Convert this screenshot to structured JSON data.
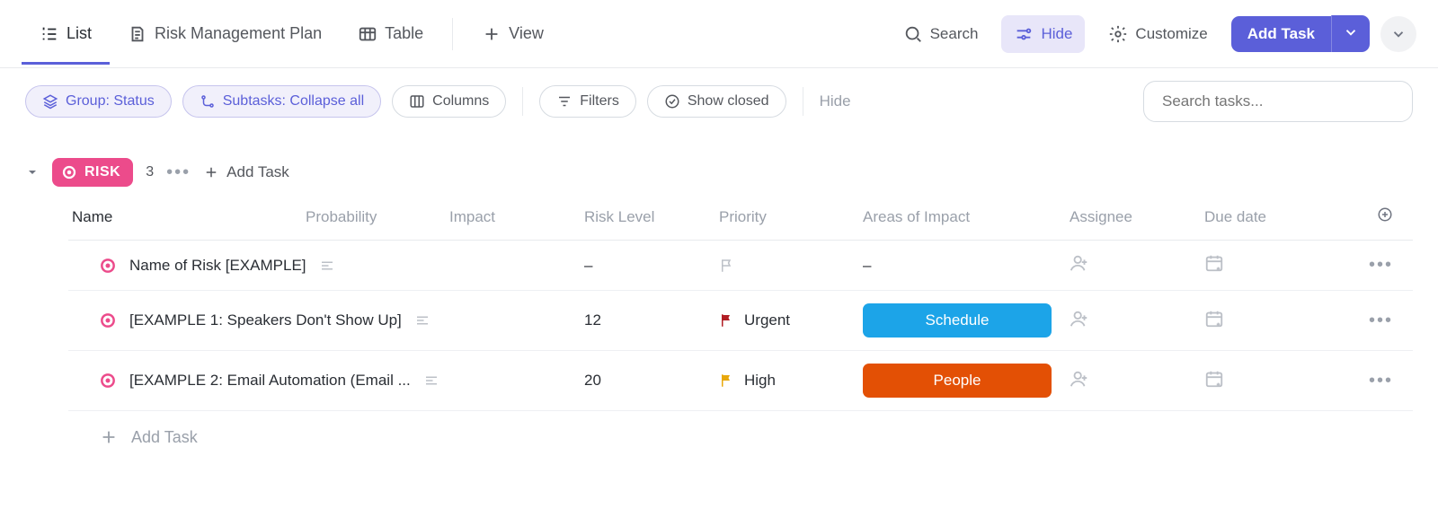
{
  "tabs": {
    "list": "List",
    "plan": "Risk Management Plan",
    "table": "Table",
    "view": "View"
  },
  "topbar": {
    "search": "Search",
    "hide": "Hide",
    "customize": "Customize",
    "add_task": "Add Task"
  },
  "filters": {
    "group": "Group: Status",
    "subtasks": "Subtasks: Collapse all",
    "columns": "Columns",
    "filters": "Filters",
    "show_closed": "Show closed",
    "hide": "Hide",
    "search_placeholder": "Search tasks..."
  },
  "group": {
    "label": "RISK",
    "count": "3",
    "add_task": "Add Task"
  },
  "columns": {
    "name": "Name",
    "probability": "Probability",
    "impact": "Impact",
    "risk_level": "Risk Level",
    "priority": "Priority",
    "areas": "Areas of Impact",
    "assignee": "Assignee",
    "due": "Due date"
  },
  "rows": [
    {
      "name": "Name of Risk [EXAMPLE]",
      "risk_level": "–",
      "priority": "",
      "priority_color": "none",
      "area": "–",
      "area_color": ""
    },
    {
      "name": "[EXAMPLE 1: Speakers Don't Show Up]",
      "risk_level": "12",
      "priority": "Urgent",
      "priority_color": "#b11e24",
      "area": "Schedule",
      "area_color": "blue"
    },
    {
      "name": "[EXAMPLE 2: Email Automation (Email ...",
      "risk_level": "20",
      "priority": "High",
      "priority_color": "#e8a80c",
      "area": "People",
      "area_color": "orange"
    }
  ],
  "add_row": "Add Task"
}
